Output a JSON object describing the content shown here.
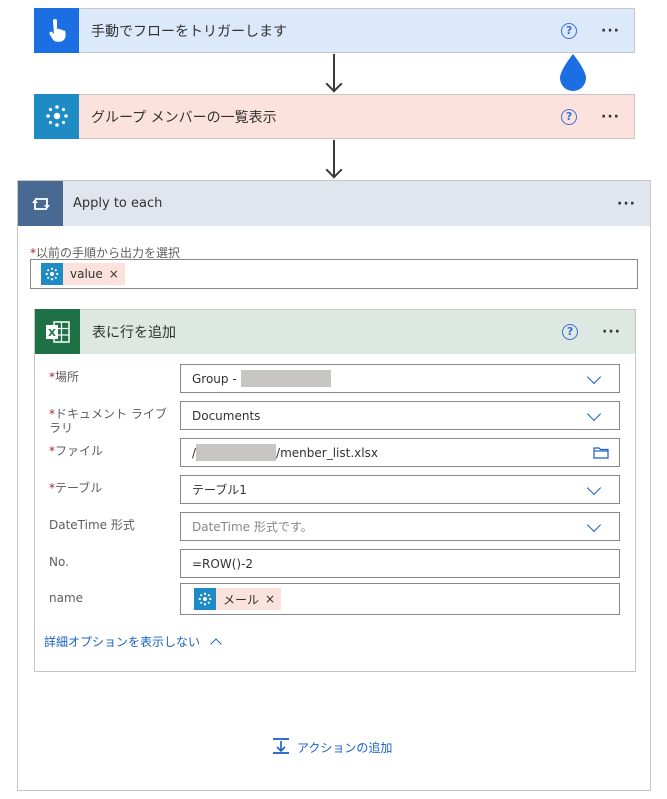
{
  "trigger": {
    "title": "手動でフローをトリガーします",
    "help": "?",
    "more": "···"
  },
  "list_members": {
    "title": "グループ メンバーの一覧表示",
    "help": "?",
    "more": "···"
  },
  "apply": {
    "title": "Apply to each",
    "more": "···",
    "select_label": "以前の手順から出力を選択",
    "token_value": "value"
  },
  "add_row": {
    "title": "表に行を追加",
    "help": "?",
    "more": "···",
    "fields": {
      "location": {
        "label": "場所",
        "value_prefix": "Group -"
      },
      "library": {
        "label": "ドキュメント ライブラリ",
        "value": "Documents"
      },
      "file": {
        "label": "ファイル",
        "value_prefix": "/",
        "value_suffix": "/menber_list.xlsx"
      },
      "table": {
        "label": "テーブル",
        "value": "テーブル1"
      },
      "datetime": {
        "label": "DateTime 形式",
        "placeholder": "DateTime 形式です。"
      },
      "no": {
        "label": "No.",
        "value": "=ROW()-2"
      },
      "name": {
        "label": "name",
        "token": "メール"
      }
    },
    "advanced_toggle": "詳細オプションを表示しない"
  },
  "add_action": "アクションの追加",
  "colors": {
    "trigger_bg": "#dbe9fb",
    "trigger_icon": "#1b6fe3",
    "list_bg": "#fbe2dc",
    "list_icon": "#1f8bc4",
    "loop_header": "#e1e6ee",
    "loop_icon": "#486991",
    "excel_header": "#dce8e1",
    "excel_icon": "#1e7145",
    "link": "#1b5fc7"
  }
}
